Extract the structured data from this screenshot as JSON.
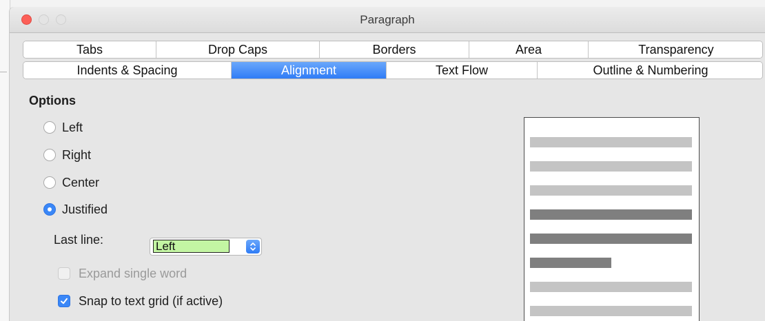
{
  "window": {
    "title": "Paragraph"
  },
  "tabs": {
    "row1": [
      "Tabs",
      "Drop Caps",
      "Borders",
      "Area",
      "Transparency"
    ],
    "row2": [
      "Indents & Spacing",
      "Alignment",
      "Text Flow",
      "Outline & Numbering"
    ],
    "active": "Alignment"
  },
  "options": {
    "title": "Options",
    "radios": [
      {
        "label": "Left",
        "checked": false
      },
      {
        "label": "Right",
        "checked": false
      },
      {
        "label": "Center",
        "checked": false
      },
      {
        "label": "Justified",
        "checked": true
      }
    ],
    "last_line_label": "Last line:",
    "last_line_value": "Left",
    "expand_single_word": {
      "label": "Expand single word",
      "checked": false,
      "disabled": true
    },
    "snap_to_grid": {
      "label": "Snap to text grid (if active)",
      "checked": true,
      "disabled": false
    }
  },
  "preview": {
    "lines": [
      "light",
      "light",
      "light",
      "dark",
      "dark",
      "dark-short",
      "light",
      "light"
    ]
  },
  "colors": {
    "accent": "#3a87f7",
    "close_button": "#fc5f57",
    "select_highlight": "#c3f5a3"
  }
}
